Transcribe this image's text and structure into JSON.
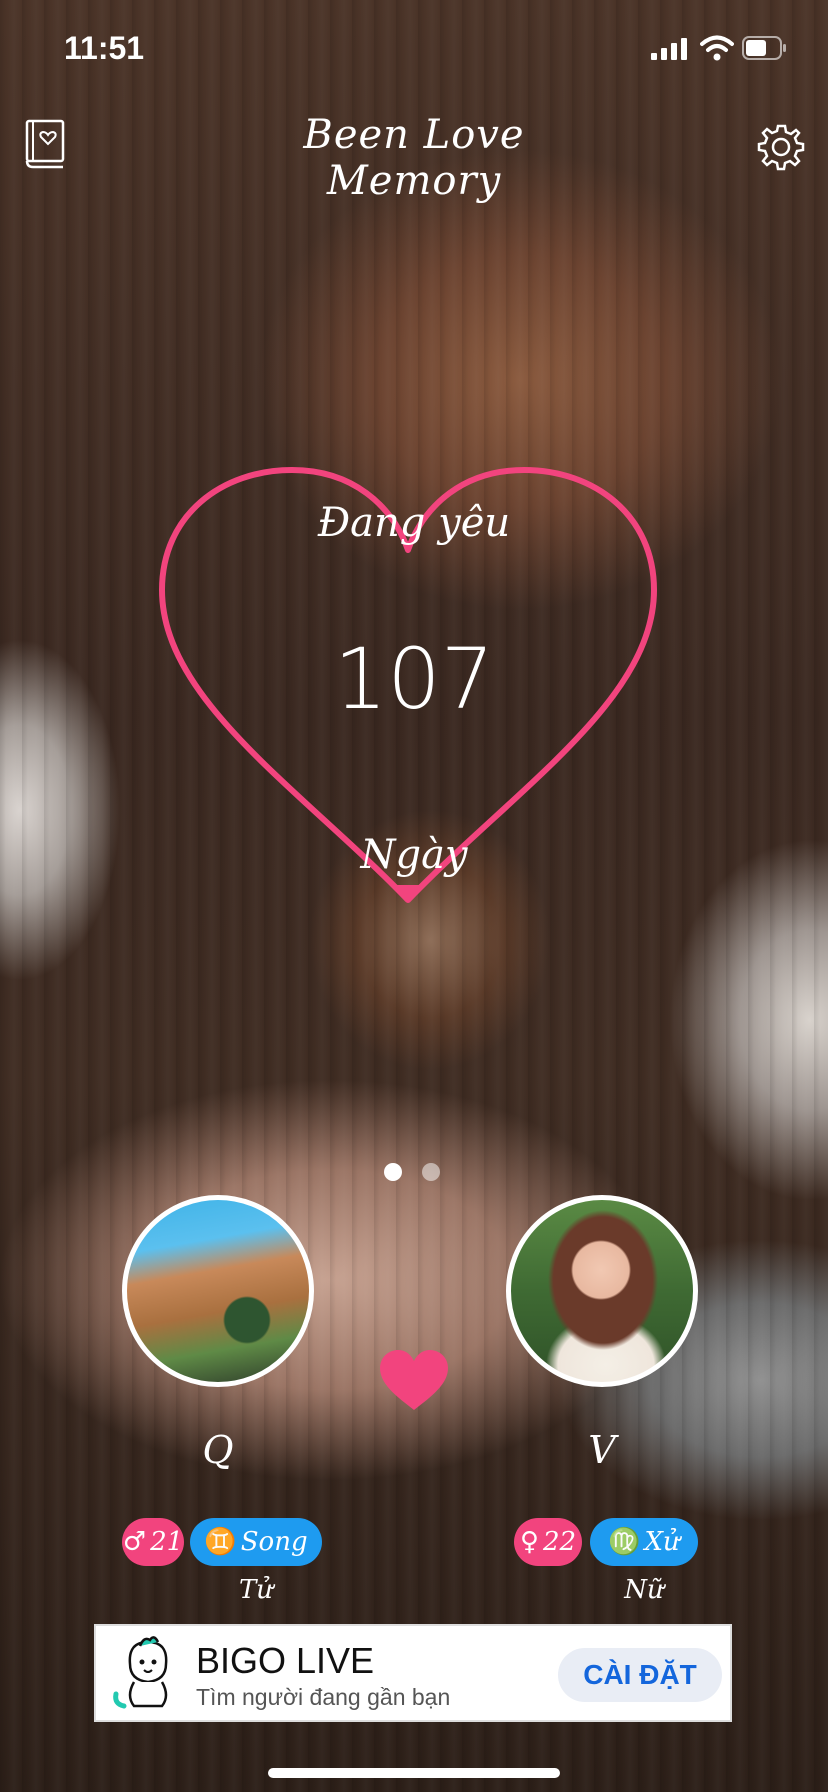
{
  "status_bar": {
    "time": "11:51"
  },
  "header": {
    "title": "Been Love Memory"
  },
  "heart": {
    "label_top": "Đang yêu",
    "count": "107",
    "label_bottom": "Ngày"
  },
  "pager": {
    "count": 2,
    "active_index": 0
  },
  "partners": [
    {
      "name": "Q",
      "age_symbol": "♂",
      "age": "21",
      "zodiac_symbol": "♊",
      "zodiac": "Song Tử"
    },
    {
      "name": "V",
      "age_symbol": "♀",
      "age": "22",
      "zodiac_symbol": "♍",
      "zodiac": "Xử Nữ"
    }
  ],
  "ad": {
    "title": "BIGO LIVE",
    "subtitle": "Tìm người đang gần bạn",
    "button": "CÀI ĐẶT"
  },
  "colors": {
    "heart_pink": "#f2447e",
    "zodiac_blue": "#1e9bf0",
    "ad_button_text": "#1466dc"
  }
}
